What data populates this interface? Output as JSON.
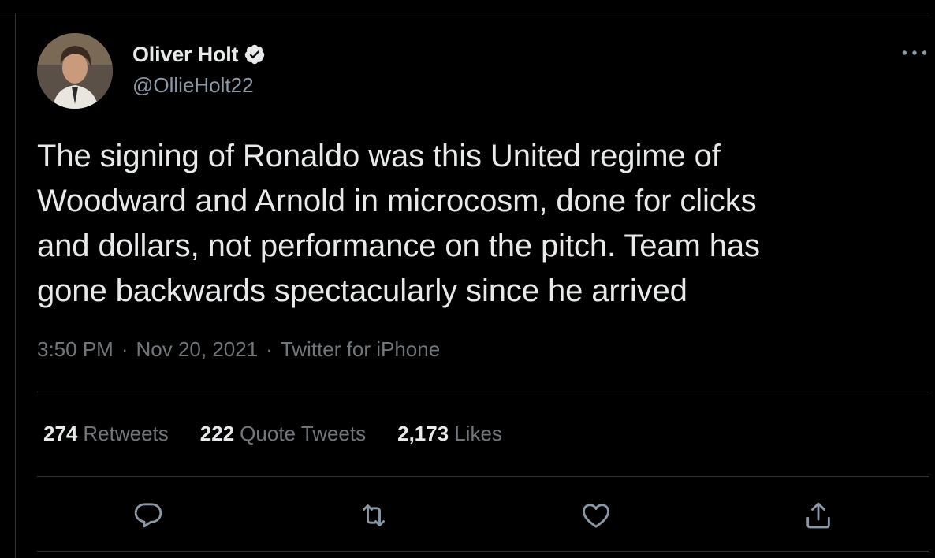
{
  "tweet": {
    "author": {
      "display_name": "Oliver Holt",
      "handle": "@OllieHolt22",
      "verified": true
    },
    "text_lines": [
      "The signing of Ronaldo was this United regime of",
      "Woodward and Arnold in microcosm, done for clicks",
      "and dollars, not performance on the pitch. Team has",
      "gone backwards spectacularly since he arrived"
    ],
    "time": "3:50 PM",
    "date": "Nov 20, 2021",
    "source": "Twitter for iPhone",
    "separator": "·"
  },
  "stats": {
    "retweets": {
      "count": "274",
      "label": "Retweets"
    },
    "quote_tweets": {
      "count": "222",
      "label": "Quote Tweets"
    },
    "likes": {
      "count": "2,173",
      "label": "Likes"
    }
  },
  "icons": {
    "more": "more-icon",
    "reply": "reply-icon",
    "retweet": "retweet-icon",
    "like": "like-icon",
    "share": "share-icon",
    "verified": "verified-badge-icon"
  },
  "colors": {
    "background": "#000000",
    "primary_text": "#e7e9ea",
    "secondary_text": "#71767b",
    "divider": "#2f3336",
    "icon": "#8b98a5"
  }
}
